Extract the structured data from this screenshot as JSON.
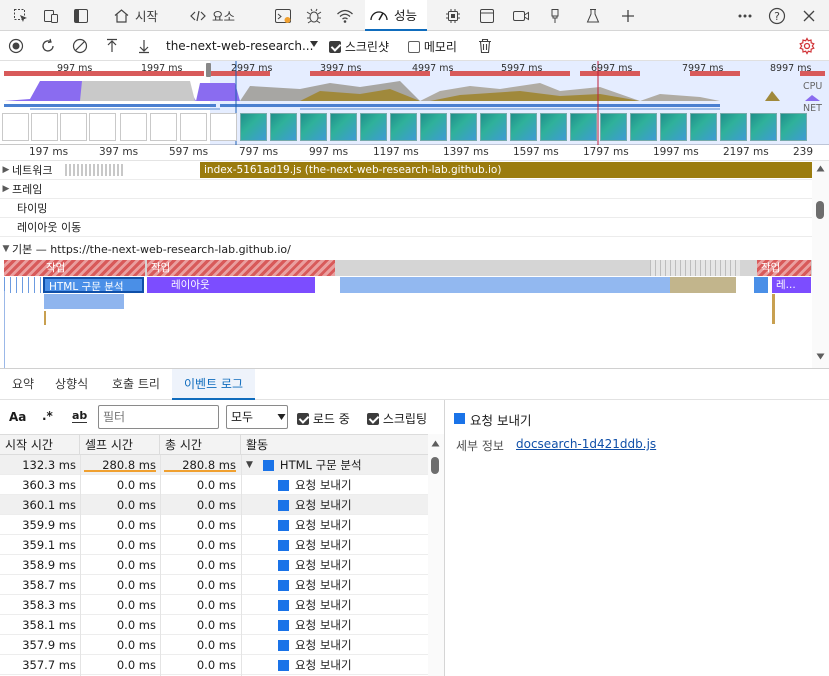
{
  "tabbar": {
    "tabs": [
      {
        "icon": "home-icon",
        "label": "시작"
      },
      {
        "icon": "code-icon",
        "label": "요소"
      },
      {
        "icon": "performance-icon",
        "label": "성능"
      }
    ],
    "more_icon": "more-icon",
    "help_icon": "help-icon",
    "close_icon": "close-icon"
  },
  "recording": {
    "profile_name": "the-next-web-research...",
    "screenshots_label": "스크린샷",
    "screenshots_checked": true,
    "memory_label": "메모리",
    "memory_checked": false
  },
  "overview": {
    "ticks": [
      "997 ms",
      "1997 ms",
      "2997 ms",
      "3997 ms",
      "4997 ms",
      "5997 ms",
      "6997 ms",
      "7997 ms",
      "8997 ms"
    ],
    "cpu_label": "CPU",
    "net_label": "NET"
  },
  "ruler": {
    "ticks": [
      "197 ms",
      "397 ms",
      "597 ms",
      "797 ms",
      "997 ms",
      "1197 ms",
      "1397 ms",
      "1597 ms",
      "1797 ms",
      "1997 ms",
      "2197 ms",
      "239"
    ]
  },
  "tracks": {
    "network_label": "네트워크",
    "network_bar": "index-5161ad19.js (the-next-web-research-lab.github.io)",
    "frames_label": "프레임",
    "timing_label": "타이밍",
    "layout_shift_label": "레이아웃 이동",
    "main_label": "기본 — https://the-next-web-research-lab.github.io/",
    "task_labels": [
      "작업",
      "작업",
      "작업"
    ],
    "parse_html_label": "HTML 구문 분석",
    "layout_label": "레이아웃",
    "truncated_label": "레..."
  },
  "bottom_tabs": [
    "요약",
    "상향식",
    "호출 트리",
    "이벤트 로그"
  ],
  "filter": {
    "match_case": "Aa",
    "regex": ".*",
    "whole_word": "ab",
    "placeholder": "필터",
    "duration_select": "모두",
    "loading_label": "로드 중",
    "scripting_label": "스크립팅"
  },
  "table": {
    "headers": [
      "시작 시간",
      "셀프 시간",
      "총 시간",
      "활동"
    ],
    "rows": [
      {
        "start": "132.3 ms",
        "self": "280.8 ms",
        "total": "280.8 ms",
        "activity": "HTML 구문 분석"
      },
      {
        "start": "360.3 ms",
        "self": "0.0 ms",
        "total": "0.0 ms",
        "activity": "요청 보내기"
      },
      {
        "start": "360.1 ms",
        "self": "0.0 ms",
        "total": "0.0 ms",
        "activity": "요청 보내기"
      },
      {
        "start": "359.9 ms",
        "self": "0.0 ms",
        "total": "0.0 ms",
        "activity": "요청 보내기"
      },
      {
        "start": "359.1 ms",
        "self": "0.0 ms",
        "total": "0.0 ms",
        "activity": "요청 보내기"
      },
      {
        "start": "358.9 ms",
        "self": "0.0 ms",
        "total": "0.0 ms",
        "activity": "요청 보내기"
      },
      {
        "start": "358.7 ms",
        "self": "0.0 ms",
        "total": "0.0 ms",
        "activity": "요청 보내기"
      },
      {
        "start": "358.3 ms",
        "self": "0.0 ms",
        "total": "0.0 ms",
        "activity": "요청 보내기"
      },
      {
        "start": "358.1 ms",
        "self": "0.0 ms",
        "total": "0.0 ms",
        "activity": "요청 보내기"
      },
      {
        "start": "357.9 ms",
        "self": "0.0 ms",
        "total": "0.0 ms",
        "activity": "요청 보내기"
      },
      {
        "start": "357.7 ms",
        "self": "0.0 ms",
        "total": "0.0 ms",
        "activity": "요청 보내기"
      }
    ]
  },
  "details": {
    "title": "요청 보내기",
    "detail_label": "세부 정보",
    "detail_link": "docsearch-1d421ddb.js"
  },
  "colors": {
    "accent": "#0f6cbd",
    "scripting": "#a0893b",
    "rendering": "#7c4dff",
    "parse": "#4a8fe7",
    "task_red": "#d85a5a"
  }
}
